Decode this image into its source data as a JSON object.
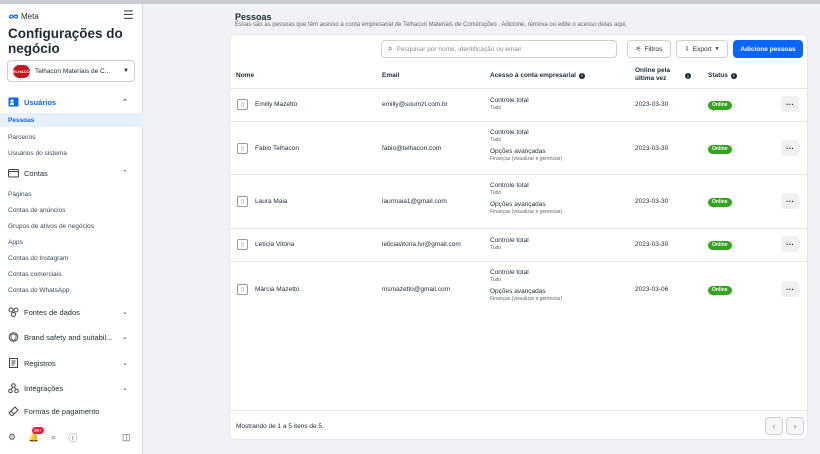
{
  "sidebar": {
    "brand": "Meta",
    "title": "Configurações do negócio",
    "business": {
      "logo_text": "TELHACON",
      "name": "Telhacon Materiais de C..."
    },
    "sections": [
      {
        "label": "Usuários",
        "icon": "users-icon",
        "items": [
          "Pessoas",
          "Parceiros",
          "Usuários do sistema"
        ]
      },
      {
        "label": "Contas",
        "icon": "accounts-icon",
        "items": [
          "Páginas",
          "Contas de anúncios",
          "Grupos de ativos de negócios",
          "Apps",
          "Contas do Instagram",
          "Contas comerciais",
          "Contas do WhatsApp"
        ]
      },
      {
        "label": "Fontes de dados",
        "icon": "data-sources-icon"
      },
      {
        "label": "Brand safety and suitabil...",
        "icon": "brand-safety-icon"
      },
      {
        "label": "Registros",
        "icon": "registers-icon"
      },
      {
        "label": "Integrações",
        "icon": "integrations-icon"
      },
      {
        "label": "Formas de pagamento",
        "icon": "payment-icon"
      }
    ],
    "footer": {
      "notification_count": "99+"
    }
  },
  "header": {
    "title": "Pessoas",
    "subtitle": "Essas são as pessoas que têm acesso à conta empresarial de Telhacon Materiais de Construções . Adicione, remova ou edite o acesso delas aqui."
  },
  "toolbar": {
    "search_placeholder": "Pesquisar por nome, identificação ou email",
    "filters_label": "Filtros",
    "export_label": "Export",
    "add_label": "Adicione pessoas"
  },
  "table": {
    "columns": {
      "name": "Nome",
      "email": "Email",
      "access": "Acesso à conta empresarial",
      "online": "Online pela última vez",
      "status": "Status"
    },
    "rows": [
      {
        "name": "Emilly Mazetto",
        "email": "emilly@soumzt.com.br",
        "access": [
          {
            "main": "Controle total",
            "sub": "Tudo"
          }
        ],
        "online": "2023-03-30",
        "status": "Online"
      },
      {
        "name": "Fabio Telhacon",
        "email": "fabio@telhacon.com",
        "access": [
          {
            "main": "Controle total",
            "sub": "Tudo"
          },
          {
            "main": "Opções avançadas",
            "sub": "Finanças (visualizar e gerenciar)"
          }
        ],
        "online": "2023-03-30",
        "status": "Online"
      },
      {
        "name": "Laura Maia",
        "email": "laurmaia1@gmail.com",
        "access": [
          {
            "main": "Controle total",
            "sub": "Tudo"
          },
          {
            "main": "Opções avançadas",
            "sub": "Finanças (visualizar e gerenciar)"
          }
        ],
        "online": "2023-03-30",
        "status": "Online"
      },
      {
        "name": "Letícia Vitória",
        "email": "leticiavitoria.lvr@gmail.com",
        "access": [
          {
            "main": "Controle total",
            "sub": "Tudo"
          }
        ],
        "online": "2023-03-30",
        "status": "Online"
      },
      {
        "name": "Márcia Mazetto",
        "email": "msmazetto@gmail.com",
        "access": [
          {
            "main": "Controle total",
            "sub": "Tudo"
          },
          {
            "main": "Opções avançadas",
            "sub": "Finanças (visualizar e gerenciar)"
          }
        ],
        "online": "2023-03-06",
        "status": "Online"
      }
    ]
  },
  "footer": {
    "summary": "Mostrando de 1 a 5 itens de 5."
  },
  "colors": {
    "accent": "#0866ff",
    "online": "#36a420"
  }
}
